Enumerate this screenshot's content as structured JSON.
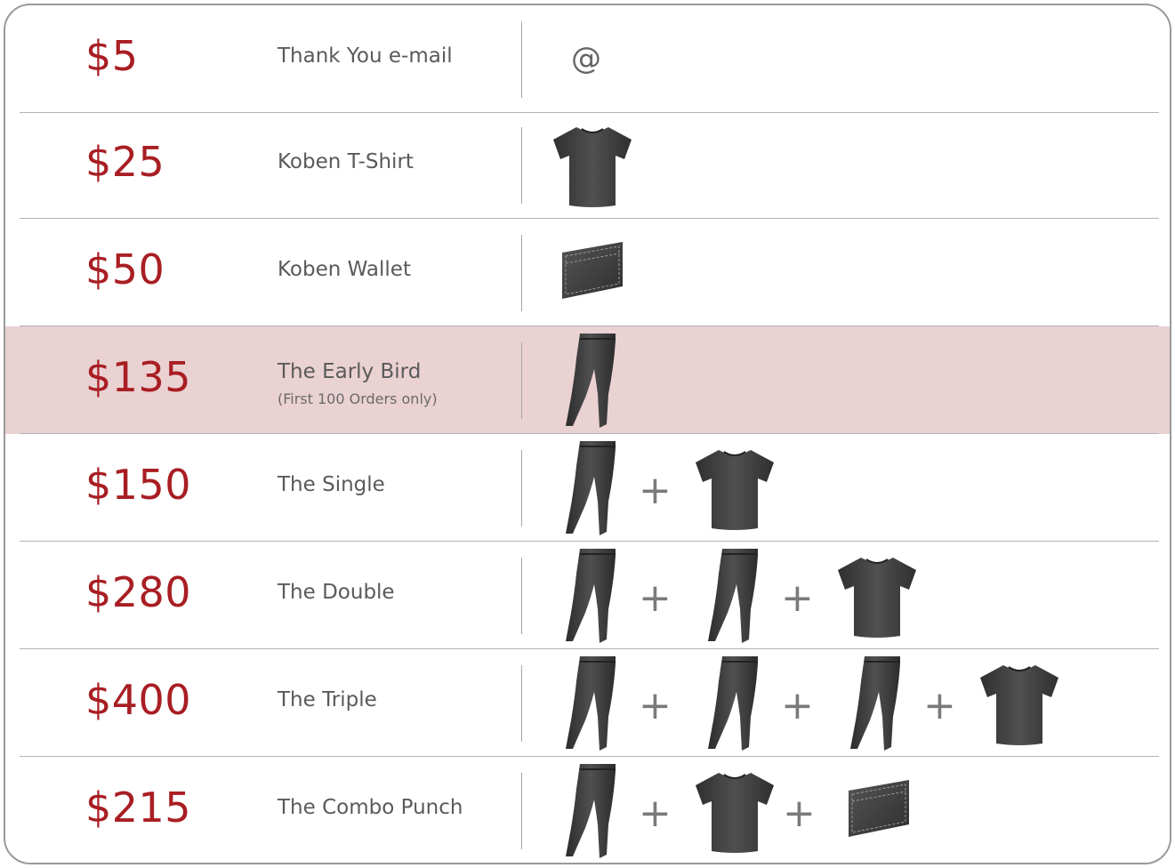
{
  "tiers": [
    {
      "price": "$5",
      "name": "Thank You e-mail",
      "note": "",
      "highlight": false,
      "items": [
        "at-sign"
      ]
    },
    {
      "price": "$25",
      "name": "Koben T-Shirt",
      "note": "",
      "highlight": false,
      "items": [
        "tshirt"
      ]
    },
    {
      "price": "$50",
      "name": "Koben Wallet",
      "note": "",
      "highlight": false,
      "items": [
        "wallet"
      ]
    },
    {
      "price": "$135",
      "name": "The Early Bird",
      "note": "(First 100 Orders only)",
      "highlight": true,
      "items": [
        "jeans"
      ]
    },
    {
      "price": "$150",
      "name": "The Single",
      "note": "",
      "highlight": false,
      "items": [
        "jeans",
        "tshirt"
      ]
    },
    {
      "price": "$280",
      "name": "The Double",
      "note": "",
      "highlight": false,
      "items": [
        "jeans",
        "jeans",
        "tshirt"
      ]
    },
    {
      "price": "$400",
      "name": "The Triple",
      "note": "",
      "highlight": false,
      "items": [
        "jeans",
        "jeans",
        "jeans",
        "tshirt"
      ]
    },
    {
      "price": "$215",
      "name": "The Combo Punch",
      "note": "",
      "highlight": false,
      "items": [
        "jeans",
        "tshirt",
        "wallet"
      ]
    }
  ],
  "plus_symbol": "+",
  "at_symbol": "@",
  "colors": {
    "price": "#a81e23",
    "highlight": "#ead1d2",
    "product": "#3e3e3e"
  }
}
